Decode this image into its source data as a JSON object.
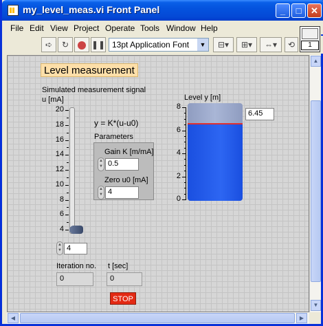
{
  "window": {
    "title": "my_level_meas.vi Front Panel"
  },
  "menu": [
    "File",
    "Edit",
    "View",
    "Project",
    "Operate",
    "Tools",
    "Window",
    "Help"
  ],
  "toolbar": {
    "font": "13pt Application Font",
    "vi_icon_number": "1"
  },
  "panel": {
    "heading": "Level measurement",
    "slider": {
      "label_line1": "Simulated measurement signal",
      "label_line2": "u [mA]",
      "min": 4,
      "max": 20,
      "value": 4,
      "ticks": [
        "20",
        "18",
        "16",
        "14",
        "12",
        "10",
        "8",
        "6",
        "4"
      ],
      "digital_value": "4"
    },
    "formula": "y = K*(u-u0)",
    "parameters": {
      "label": "Parameters",
      "gain_label": "Gain K [m/mA]",
      "gain_value": "0.5",
      "zero_label": "Zero u0 [mA]",
      "zero_value": "4"
    },
    "tank": {
      "label": "Level y [m]",
      "min": 0,
      "max": 8,
      "level": 6.45,
      "ticks": [
        "8",
        "6",
        "4",
        "2",
        "0"
      ],
      "digital_value": "6.45",
      "fill_color": "#1a4fe0",
      "empty_color": "#a9b6d6",
      "line_color": "#e03030"
    },
    "iteration": {
      "label": "Iteration no.",
      "value": "0"
    },
    "time": {
      "label": "t [sec]",
      "value": "0"
    },
    "stop_label": "STOP"
  }
}
